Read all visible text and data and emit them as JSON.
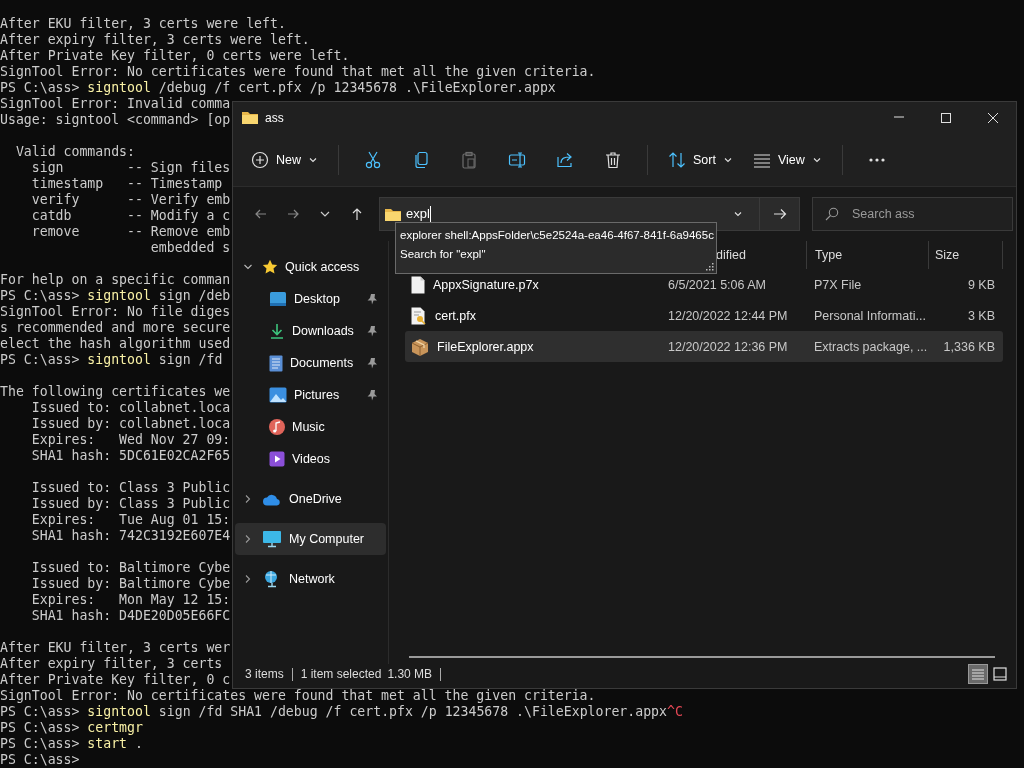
{
  "terminal": {
    "lines": [
      {
        "kind": "output",
        "text": "After EKU filter, 3 certs were left."
      },
      {
        "kind": "output",
        "text": "After expiry filter, 3 certs were left."
      },
      {
        "kind": "output",
        "text": "After Private Key filter, 0 certs were left."
      },
      {
        "kind": "output",
        "text": "SignTool Error: No certificates were found that met all the given criteria."
      },
      {
        "kind": "prompt",
        "prompt": "PS C:\\ass>",
        "command": "signtool",
        "args": "/debug /f cert.pfx /p 12345678 .\\FileExplorer.appx"
      },
      {
        "kind": "output",
        "text": "SignTool Error: Invalid comma"
      },
      {
        "kind": "output",
        "text": "Usage: signtool <command> [op"
      },
      {
        "kind": "blank"
      },
      {
        "kind": "output",
        "text": "  Valid commands:"
      },
      {
        "kind": "output",
        "text": "    sign        -- Sign files"
      },
      {
        "kind": "output",
        "text": "    timestamp   -- Timestamp"
      },
      {
        "kind": "output",
        "text": "    verify      -- Verify emb"
      },
      {
        "kind": "output",
        "text": "    catdb       -- Modify a c"
      },
      {
        "kind": "output",
        "text": "    remove      -- Remove emb"
      },
      {
        "kind": "output",
        "text": "                   embedded s"
      },
      {
        "kind": "blank"
      },
      {
        "kind": "output",
        "text": "For help on a specific comman"
      },
      {
        "kind": "prompt",
        "prompt": "PS C:\\ass>",
        "command": "signtool",
        "args": "sign /deb"
      },
      {
        "kind": "output",
        "text": "SignTool Error: No file diges"
      },
      {
        "kind": "output",
        "text": "s recommended and more secure"
      },
      {
        "kind": "output",
        "text": "elect the hash algorithm used"
      },
      {
        "kind": "prompt",
        "prompt": "PS C:\\ass>",
        "command": "signtool",
        "args": "sign /fd"
      },
      {
        "kind": "blank"
      },
      {
        "kind": "output",
        "text": "The following certificates we"
      },
      {
        "kind": "output",
        "text": "    Issued to: collabnet.loca"
      },
      {
        "kind": "output",
        "text": "    Issued by: collabnet.loca"
      },
      {
        "kind": "output",
        "text": "    Expires:   Wed Nov 27 09:"
      },
      {
        "kind": "output",
        "text": "    SHA1 hash: 5DC61E02CA2F65"
      },
      {
        "kind": "blank"
      },
      {
        "kind": "output",
        "text": "    Issued to: Class 3 Public"
      },
      {
        "kind": "output",
        "text": "    Issued by: Class 3 Public"
      },
      {
        "kind": "output",
        "text": "    Expires:   Tue Aug 01 15:"
      },
      {
        "kind": "output",
        "text": "    SHA1 hash: 742C3192E607E4"
      },
      {
        "kind": "blank"
      },
      {
        "kind": "output",
        "text": "    Issued to: Baltimore Cybe"
      },
      {
        "kind": "output",
        "text": "    Issued by: Baltimore Cybe"
      },
      {
        "kind": "output",
        "text": "    Expires:   Mon May 12 15:"
      },
      {
        "kind": "output",
        "text": "    SHA1 hash: D4DE20D05E66FC"
      },
      {
        "kind": "blank"
      },
      {
        "kind": "output",
        "text": "After EKU filter, 3 certs wer"
      },
      {
        "kind": "output",
        "text": "After expiry filter, 3 certs"
      },
      {
        "kind": "output",
        "text": "After Private Key filter, 0 c"
      },
      {
        "kind": "output",
        "text": "SignTool Error: No certificates were found that met all the given criteria."
      },
      {
        "kind": "prompt",
        "prompt": "PS C:\\ass>",
        "command": "signtool",
        "args": "sign /fd SHA1 /debug /f cert.pfx /p 12345678 .\\FileExplorer.appx",
        "interrupt": "^C"
      },
      {
        "kind": "prompt",
        "prompt": "PS C:\\ass>",
        "command": "certmgr"
      },
      {
        "kind": "prompt",
        "prompt": "PS C:\\ass>",
        "command": "start",
        "args": "."
      },
      {
        "kind": "prompt",
        "prompt": "PS C:\\ass>"
      }
    ]
  },
  "window": {
    "title": "ass"
  },
  "toolbar": {
    "buttons": [
      {
        "kind": "new",
        "label": "New",
        "disabled": false
      },
      {
        "kind": "cut",
        "disabled": false
      },
      {
        "kind": "copy",
        "disabled": false
      },
      {
        "kind": "paste",
        "disabled": true
      },
      {
        "kind": "rename",
        "disabled": false
      },
      {
        "kind": "share",
        "disabled": false
      },
      {
        "kind": "delete",
        "disabled": false
      },
      {
        "kind": "sort",
        "label": "Sort",
        "disabled": false
      },
      {
        "kind": "view",
        "label": "View",
        "disabled": false
      },
      {
        "kind": "more",
        "disabled": false
      }
    ]
  },
  "address_bar": {
    "value": "expl",
    "suggestions": [
      "explorer shell:AppsFolder\\c5e2524a-ea46-4f67-841f-6a9465c",
      "Search for \"expl\""
    ]
  },
  "search": {
    "placeholder": "Search ass"
  },
  "sidebar": {
    "items": [
      {
        "kind": "star",
        "label": "Quick access",
        "expanded": true,
        "selected": false,
        "children": [
          {
            "kind": "desktop",
            "label": "Desktop",
            "pinned": true,
            "selected": false
          },
          {
            "kind": "download",
            "label": "Downloads",
            "pinned": true,
            "selected": false
          },
          {
            "kind": "document",
            "label": "Documents",
            "pinned": true,
            "selected": false
          },
          {
            "kind": "picture",
            "label": "Pictures",
            "pinned": true,
            "selected": false
          },
          {
            "kind": "music",
            "label": "Music",
            "pinned": false,
            "selected": false
          },
          {
            "kind": "video",
            "label": "Videos",
            "pinned": false,
            "selected": false
          }
        ]
      },
      {
        "kind": "cloud",
        "label": "OneDrive",
        "expanded": false,
        "selected": false
      },
      {
        "kind": "computer",
        "label": "My Computer",
        "expanded": false,
        "selected": true
      },
      {
        "kind": "network",
        "label": "Network",
        "expanded": false,
        "selected": false
      }
    ]
  },
  "files": {
    "columns": [
      "dified",
      "Type",
      "Size"
    ],
    "rows": [
      {
        "kind": "file",
        "name": "AppxSignature.p7x",
        "date": "6/5/2021 5:06 AM",
        "type": "P7X File",
        "size": "9 KB",
        "selected": false
      },
      {
        "kind": "certificate",
        "name": "cert.pfx",
        "date": "12/20/2022 12:44 PM",
        "type": "Personal Informati...",
        "size": "3 KB",
        "selected": false
      },
      {
        "kind": "package",
        "name": "FileExplorer.appx",
        "date": "12/20/2022 12:36 PM",
        "type": "Extracts package, ...",
        "size": "1,336 KB",
        "selected": true
      }
    ]
  },
  "status_bar": {
    "item_count": "3 items",
    "selection": "1 item selected",
    "selection_size": "1.30 MB",
    "views": [
      {
        "kind": "details",
        "selected": true
      },
      {
        "kind": "tiles",
        "selected": false
      }
    ]
  }
}
